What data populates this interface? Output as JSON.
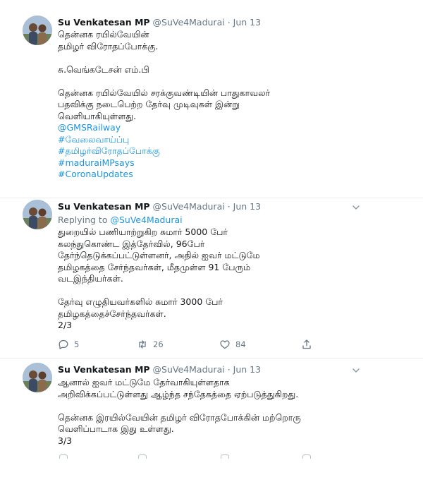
{
  "tweets": [
    {
      "author": {
        "name": "Su Venkatesan MP",
        "handle": "@SuVe4Madurai",
        "separator": "·",
        "date": "Jun 13"
      },
      "lines": [
        {
          "text": "தென்னக ரயில்வேயின்",
          "type": "text"
        },
        {
          "text": "தமிழர் விரோதப்போக்கு.",
          "type": "text"
        },
        {
          "text": "",
          "type": "gap"
        },
        {
          "text": "சு.வெங்கடேசன் எம்.பி",
          "type": "text"
        },
        {
          "text": "",
          "type": "gap"
        },
        {
          "text": "தென்னக ரயில்வேயில் சரக்குவண்டியின் பாதுகாவலர்",
          "type": "text"
        },
        {
          "text": "பதவிக்கு நடைபெற்ற தேர்வு முடிவுகள் இன்று",
          "type": "text"
        },
        {
          "text": "வெளியாகியுள்ளது.",
          "type": "text"
        },
        {
          "text": "@GMSRailway",
          "type": "link"
        },
        {
          "text": "#வேலைவாய்ப்பு",
          "type": "link"
        },
        {
          "text": "#தமிழர்விரோதப்போக்கு",
          "type": "link"
        },
        {
          "text": "#maduraiMPsays",
          "type": "link"
        },
        {
          "text": "#CoronaUpdates",
          "type": "link"
        }
      ]
    },
    {
      "author": {
        "name": "Su Venkatesan MP",
        "handle": "@SuVe4Madurai",
        "separator": "·",
        "date": "Jun 13"
      },
      "reply": {
        "prefix": "Replying to",
        "mention": "@SuVe4Madurai"
      },
      "lines": [
        {
          "text": "துறையில் பணியாற்றுகிற சுமார் 5000 பேர்",
          "type": "text"
        },
        {
          "text": "கலந்துகொண்ட இத்தேர்வில், 96பேர்",
          "type": "text"
        },
        {
          "text": "தேர்ந்தெடுக்கப்பட்டுள்ளனர், அதில் ஐவர் மட்டுமே",
          "type": "text"
        },
        {
          "text": "தமிழகத்தை சேர்ந்தவர்கள், மீதமுள்ள 91 பேரும்",
          "type": "text"
        },
        {
          "text": "வடஇந்தியர்கள்.",
          "type": "text"
        },
        {
          "text": "",
          "type": "gap"
        },
        {
          "text": "தேர்வு எழுதியவர்களில் சுமார் 3000 பேர்",
          "type": "text"
        },
        {
          "text": "தமிழகத்தைச்சேர்ந்தவர்கள்.",
          "type": "text"
        },
        {
          "text": "2/3",
          "type": "counter"
        }
      ],
      "actions": {
        "replies": "5",
        "retweets": "26",
        "likes": "84"
      }
    },
    {
      "author": {
        "name": "Su Venkatesan MP",
        "handle": "@SuVe4Madurai",
        "separator": "·",
        "date": "Jun 13"
      },
      "lines": [
        {
          "text": "ஆனால் ஐவர் மட்டுமே தேர்வாகியுள்ளதாக",
          "type": "text"
        },
        {
          "text": "அறிவிக்கப்பட்டுள்ளது ஆழ்ந்த சந்தேகத்தை ஏற்படுத்துகிறது.",
          "type": "text"
        },
        {
          "text": "",
          "type": "gap"
        },
        {
          "text": "தென்னக இரயில்வேயின் தமிழர் விரோதபோக்கின் மற்றொரு",
          "type": "text"
        },
        {
          "text": "வெளிப்பாடாக இது உள்ளது.",
          "type": "text"
        },
        {
          "text": "3/3",
          "type": "counter"
        }
      ]
    }
  ],
  "icons": {
    "caret": "chevron-down-icon",
    "reply": "reply-icon",
    "retweet": "retweet-icon",
    "like": "heart-icon",
    "share": "share-icon"
  },
  "colors": {
    "link": "#1b95e0",
    "muted": "#657786",
    "divider": "#e6ecf0",
    "text": "#14171a"
  }
}
